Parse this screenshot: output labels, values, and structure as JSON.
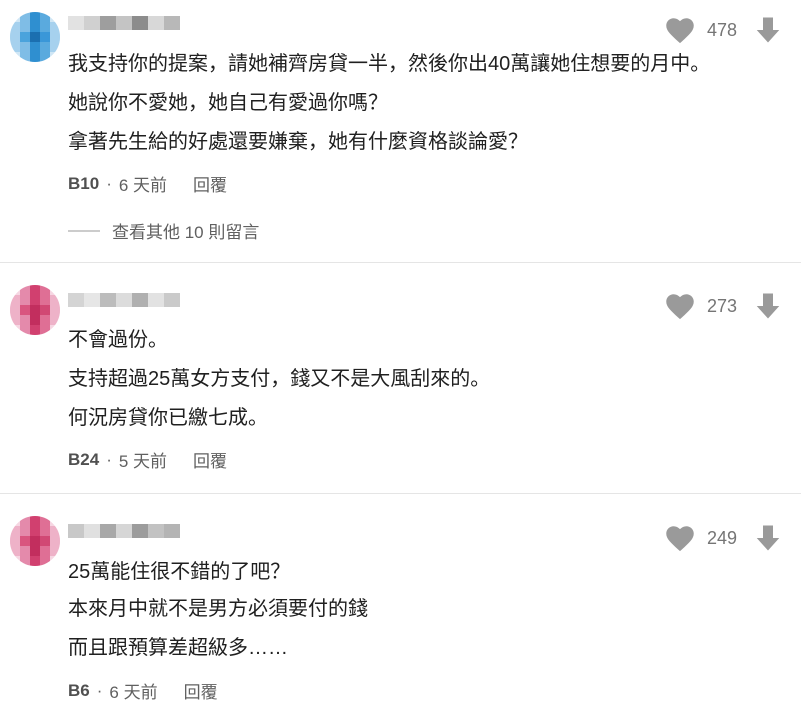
{
  "comments": [
    {
      "likes": "478",
      "lines": [
        "我支持你的提案，請她補齊房貸一半，然後你出40萬讓她住想要的月中。",
        "她說你不愛她，她自己有愛過你嗎？",
        "拿著先生給的好處還要嫌棄，她有什麼資格談論愛？"
      ],
      "floor": "B10",
      "time": "6 天前",
      "reply_label": "回覆",
      "more_replies": "查看其他 10 則留言",
      "avatar_color": "#3a9bd6"
    },
    {
      "likes": "273",
      "lines": [
        "不會過份。",
        "支持超過25萬女方支付，錢又不是大風刮來的。",
        "何況房貸你已繳七成。"
      ],
      "floor": "B24",
      "time": "5 天前",
      "reply_label": "回覆",
      "avatar_color": "#d64a7a"
    },
    {
      "likes": "249",
      "lines": [
        "25萬能住很不錯的了吧？",
        "本來月中就不是男方必須要付的錢",
        "而且跟預算差超級多……"
      ],
      "floor": "B6",
      "time": "6 天前",
      "reply_label": "回覆",
      "avatar_color": "#d64a7a"
    }
  ],
  "separator": "·",
  "icons": {
    "like": "heart-icon",
    "downvote": "thumb-down-arrow-icon"
  },
  "colors": {
    "icon_gray": "#888888",
    "text": "#202020",
    "meta": "#606060"
  }
}
